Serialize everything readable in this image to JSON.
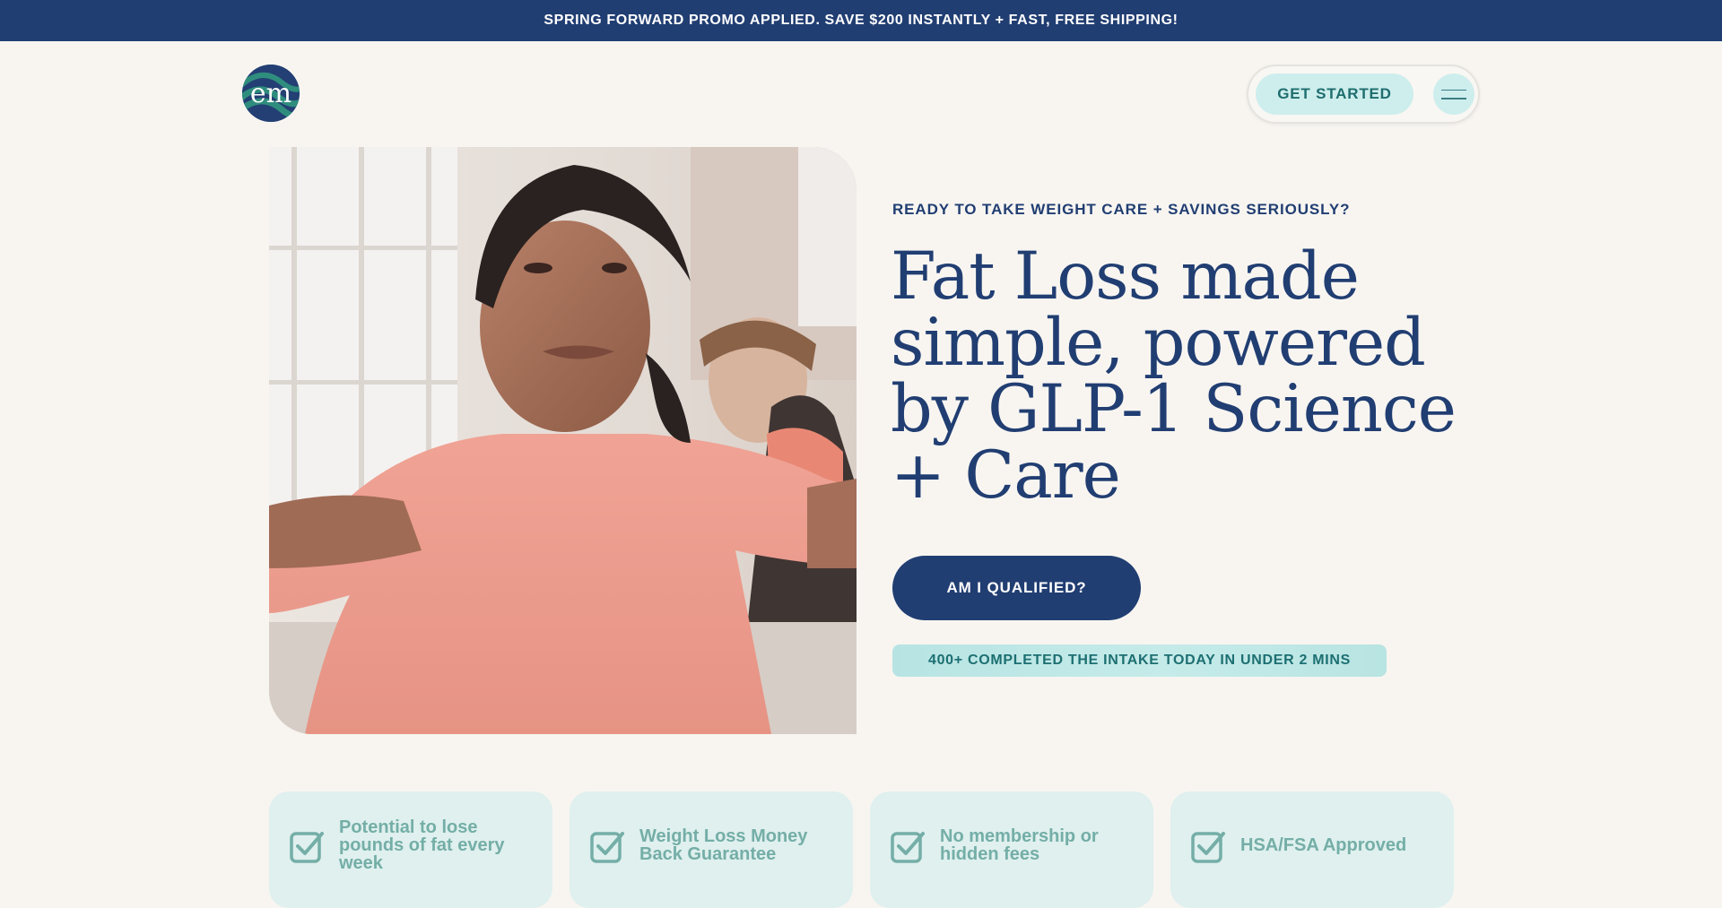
{
  "promo": {
    "text": "SPRING FORWARD PROMO APPLIED. SAVE $200 INSTANTLY + FAST, FREE SHIPPING!"
  },
  "header": {
    "logo_text": "em",
    "get_started_label": "GET STARTED",
    "menu_icon": "hamburger-menu-icon"
  },
  "hero": {
    "image": "woman-exercising-photo",
    "eyebrow": "READY TO TAKE WEIGHT CARE + SAVINGS SERIOUSLY?",
    "headline": "Fat Loss made simple, powered by GLP-1 Science + Care",
    "cta_label": "AM I QUALIFIED?",
    "social_proof": "400+ COMPLETED THE INTAKE TODAY IN UNDER 2 MINS"
  },
  "features": [
    {
      "text": "Potential to lose pounds of fat every week",
      "icon": "checkbox-check-icon"
    },
    {
      "text": "Weight Loss Money Back Guarantee",
      "icon": "checkbox-check-icon"
    },
    {
      "text": "No membership or hidden fees",
      "icon": "checkbox-check-icon"
    },
    {
      "text": "HSA/FSA Approved",
      "icon": "checkbox-check-icon"
    }
  ],
  "colors": {
    "navy": "#213e72",
    "teal_light": "#cdeeed",
    "teal_text": "#1e6d6e",
    "card_bg": "#dff0ee",
    "card_text": "#74aea7",
    "page_bg": "#f8f5f1"
  }
}
